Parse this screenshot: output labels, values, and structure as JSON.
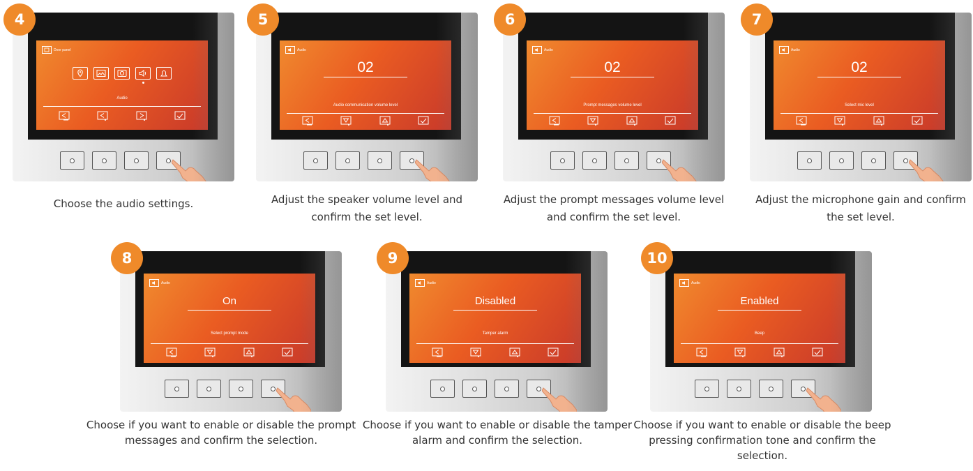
{
  "steps": [
    {
      "number": "4",
      "screen_title": "Door panel",
      "screen_label": "Audio",
      "caption": "Choose the audio settings."
    },
    {
      "number": "5",
      "screen_title": "Audio",
      "value": "02",
      "screen_label": "Audio communication volume level",
      "caption": "Adjust the speaker volume level and confirm the set level."
    },
    {
      "number": "6",
      "screen_title": "Audio",
      "value": "02",
      "screen_label": "Prompt messages volume level",
      "caption": "Adjust the prompt messages volume level and confirm the set level."
    },
    {
      "number": "7",
      "screen_title": "Audio",
      "value": "02",
      "screen_label": "Select mic level",
      "caption": "Adjust the microphone gain and confirm the set level."
    },
    {
      "number": "8",
      "screen_title": "Audio",
      "value": "On",
      "screen_label": "Select prompt mode",
      "caption": "Choose if you want to enable or disable the prompt messages and confirm the selection."
    },
    {
      "number": "9",
      "screen_title": "Audio",
      "value": "Disabled",
      "screen_label": "Tamper alarm",
      "caption": "Choose if you want to enable or disable the tamper alarm and confirm the selection."
    },
    {
      "number": "10",
      "screen_title": "Audio",
      "value": "Enabled",
      "screen_label": "Beep",
      "caption": "Choose if you want to enable or disable the beep pressing confirmation tone and confirm the selection."
    }
  ],
  "colors": {
    "badge": "#ef8a2a",
    "screen_start": "#f08a2e",
    "screen_end": "#c8392a",
    "caption_text": "#333333"
  },
  "icons": {
    "menu": [
      "location-icon",
      "image-icon",
      "camera-icon",
      "speaker-icon",
      "bell-icon"
    ],
    "level_softkeys": [
      "back-icon",
      "down-icon",
      "up-icon",
      "confirm-icon"
    ],
    "menu_softkeys": [
      "back-icon",
      "left-icon",
      "right-icon",
      "confirm-icon"
    ]
  }
}
